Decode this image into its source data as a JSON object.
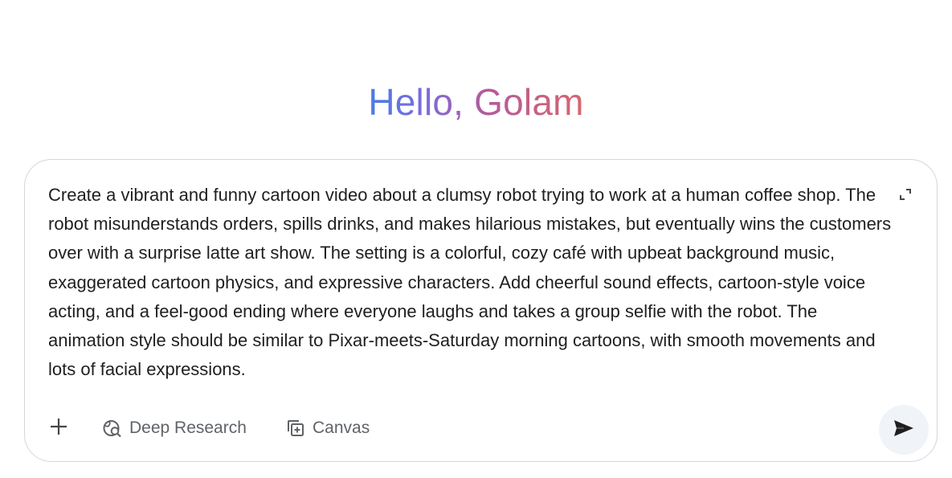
{
  "greeting": {
    "text": "Hello, Golam"
  },
  "composer": {
    "prompt_value": "Create a vibrant and funny cartoon video about a clumsy robot trying to work at a human coffee shop. The robot misunderstands orders, spills drinks, and makes hilarious mistakes, but eventually wins the customers over with a surprise latte art show. The setting is a colorful, cozy café with upbeat background music, exaggerated cartoon physics, and expressive characters. Add cheerful sound effects, cartoon-style voice acting, and a feel-good ending where everyone laughs and takes a group selfie with the robot. The animation style should be similar to Pixar-meets-Saturday morning cartoons, with smooth movements and lots of facial expressions.",
    "expand_icon": "expand-icon",
    "toolbar": {
      "add_icon": "plus-icon",
      "deep_research_label": "Deep Research",
      "deep_research_icon": "globe-search-icon",
      "canvas_label": "Canvas",
      "canvas_icon": "canvas-add-icon",
      "send_icon": "send-icon"
    }
  },
  "colors": {
    "greeting_gradient_start": "#4a7ce8",
    "greeting_gradient_end": "#d8656e",
    "text": "#1f1f1f",
    "muted": "#5f6368",
    "send_bg": "#f0f4f9",
    "border": "#d3d6da"
  }
}
